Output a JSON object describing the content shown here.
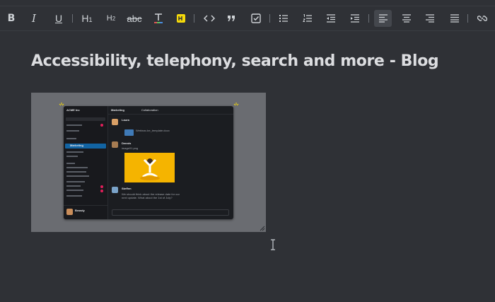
{
  "toolbar": {
    "buttons": [
      {
        "name": "bold-button",
        "icon": "bold-icon",
        "label": "B"
      },
      {
        "name": "italic-button",
        "icon": "italic-icon",
        "label": "I"
      },
      {
        "name": "underline-button",
        "icon": "underline-icon",
        "label": "U"
      },
      {
        "name": "heading-1-button",
        "icon": "heading-1-icon",
        "label": "H1"
      },
      {
        "name": "heading-2-button",
        "icon": "heading-2-icon",
        "label": "H2"
      },
      {
        "name": "strikethrough-button",
        "icon": "strikethrough-icon",
        "label": "abc"
      },
      {
        "name": "text-color-button",
        "icon": "text-color-icon",
        "label": "T"
      },
      {
        "name": "highlight-button",
        "icon": "highlight-icon"
      },
      {
        "name": "code-button",
        "icon": "code-icon",
        "label": "<>"
      },
      {
        "name": "quote-button",
        "icon": "quote-icon",
        "label": "”"
      },
      {
        "name": "checklist-button",
        "icon": "checkbox-icon"
      },
      {
        "name": "bullet-list-button",
        "icon": "bullet-list-icon"
      },
      {
        "name": "ordered-list-button",
        "icon": "ordered-list-icon"
      },
      {
        "name": "outdent-button",
        "icon": "outdent-icon"
      },
      {
        "name": "indent-button",
        "icon": "indent-icon"
      },
      {
        "name": "align-left-button",
        "icon": "align-left-icon",
        "active": true
      },
      {
        "name": "align-center-button",
        "icon": "align-center-icon"
      },
      {
        "name": "align-right-button",
        "icon": "align-right-icon"
      },
      {
        "name": "align-justify-button",
        "icon": "align-justify-icon"
      },
      {
        "name": "link-button",
        "icon": "link-icon"
      }
    ]
  },
  "document": {
    "title": "Accessibility, telephony, search and more - Blog"
  },
  "embedded_image": {
    "description_icon": "slack-app-screenshot",
    "workspace": "ACME Inc",
    "channel": "Marketing",
    "tab": "Collaboration",
    "sidebar_selected": "Marketing",
    "user": "Brandy",
    "messages": [
      {
        "author": "Laura",
        "text": "Webinar-be_template.docx"
      },
      {
        "author": "Dennis",
        "text": "image01.png"
      },
      {
        "author": "Steffen",
        "text": "We should think about the release date for our next update. What about the 1st of July?"
      }
    ]
  },
  "colors": {
    "background": "#2f3136",
    "text": "#dcdde0",
    "icon": "#cfd3d7",
    "active": "#44474d",
    "highlight_yellow": "#f5d90a",
    "text_color_red": "#e05555",
    "chat_image_yellow": "#f5b400",
    "selection_blue": "#1264a3"
  }
}
